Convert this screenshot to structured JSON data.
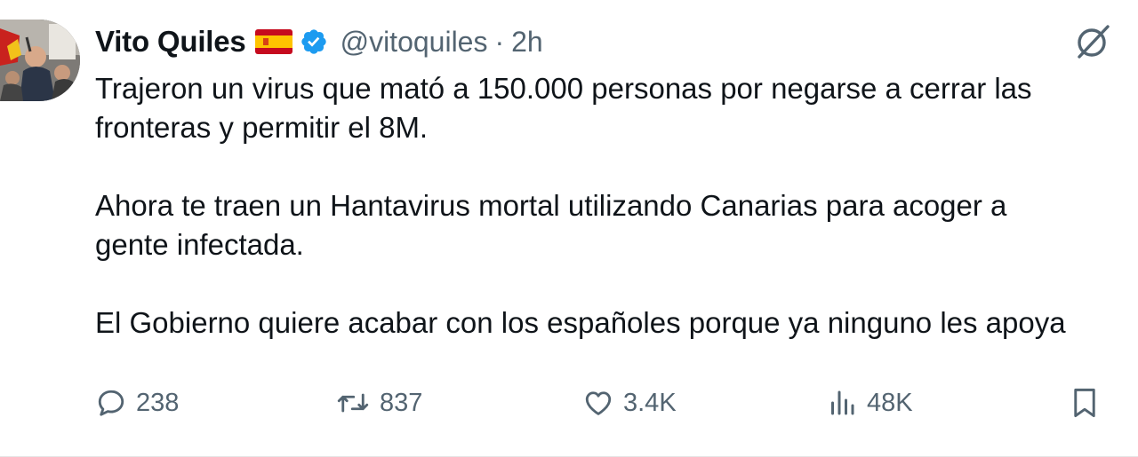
{
  "author": {
    "display_name": "Vito Quiles",
    "handle": "@vitoquiles",
    "separator": "·",
    "time_ago": "2h",
    "flag_icon": "spain-flag-icon",
    "verified_icon": "verified-badge-icon",
    "verified_color": "#1d9bf0"
  },
  "tweet": {
    "paragraphs": [
      "Trajeron un virus que mató a 150.000 personas por negarse a cerrar las fronteras y permitir el 8M.",
      "Ahora te traen un Hantavirus mortal utilizando Canarias para acoger a gente infectada.",
      "El Gobierno quiere acabar con los españoles porque ya ninguno les apoya"
    ],
    "lines": [
      [
        "Trajeron un virus que mató a 150.000 personas por negarse a cerrar las",
        "fronteras y permitir el 8M."
      ],
      [
        "Ahora te traen un Hantavirus mortal utilizando Canarias para acoger a",
        "gente infectada."
      ],
      [
        "El Gobierno quiere acabar con los españoles porque ya ninguno les apoya"
      ]
    ]
  },
  "actions": {
    "replies": "238",
    "reposts": "837",
    "likes": "3.4K",
    "views": "48K",
    "icons": [
      "reply-icon",
      "repost-icon",
      "like-icon",
      "views-icon",
      "bookmark-icon"
    ]
  },
  "colors": {
    "text": "#0f1419",
    "secondary": "#536471",
    "accent": "#1d9bf0"
  }
}
